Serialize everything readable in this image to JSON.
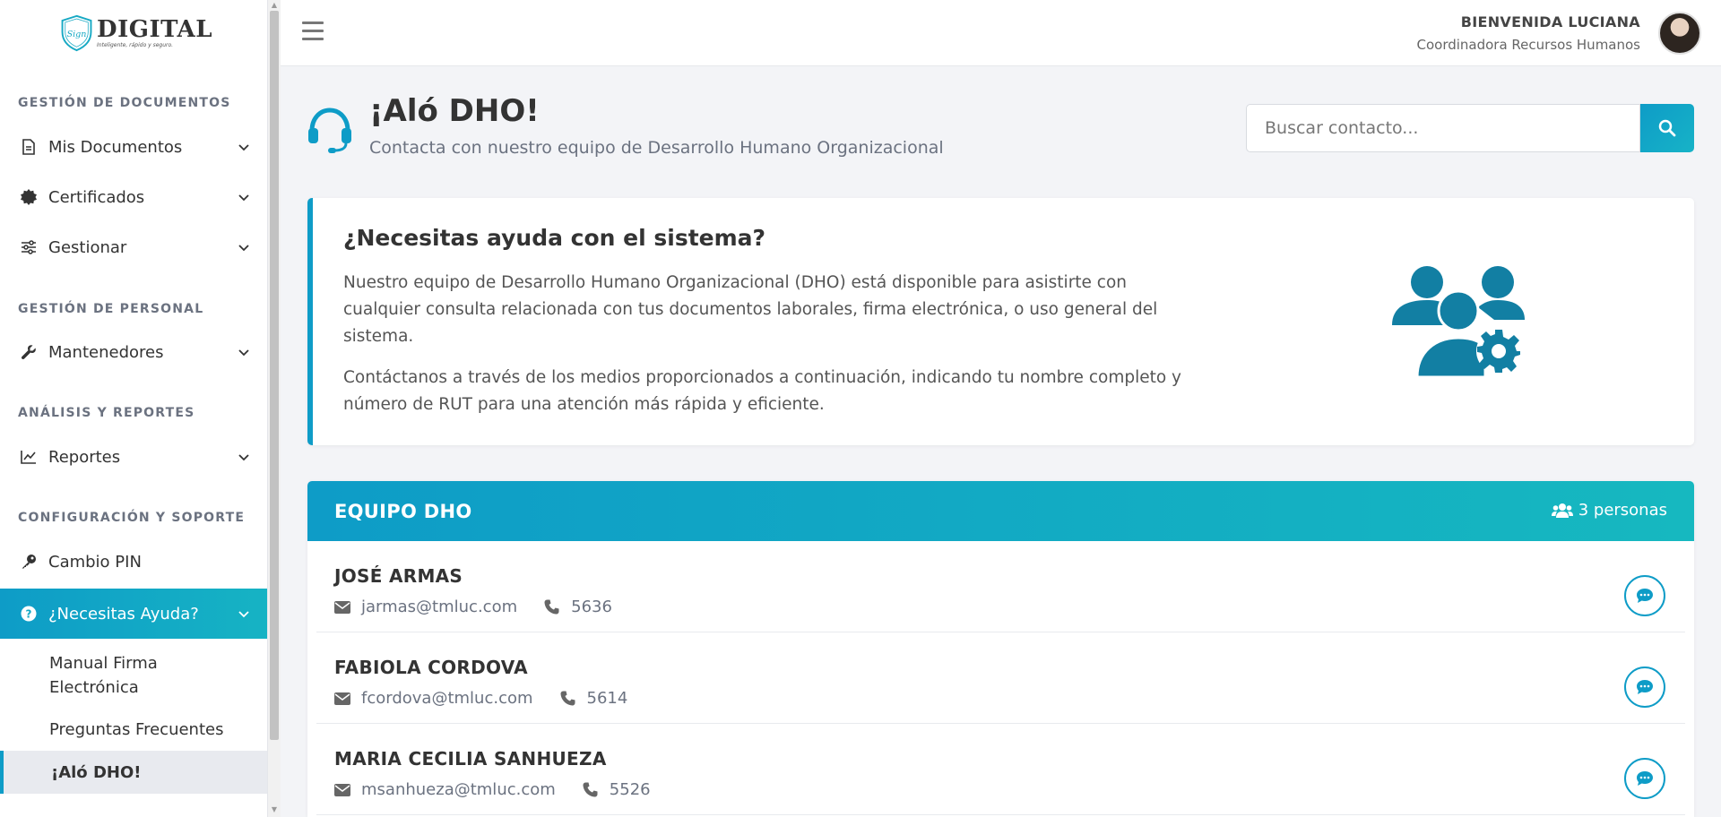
{
  "brand": {
    "logo_script": "Sign",
    "logo_word": "DIGITAL",
    "logo_tagline": "Inteligente, rápido y seguro."
  },
  "sidebar": {
    "sections": [
      {
        "title": "GESTIÓN DE DOCUMENTOS"
      },
      {
        "title": "GESTIÓN DE PERSONAL"
      },
      {
        "title": "ANÁLISIS Y REPORTES"
      },
      {
        "title": "CONFIGURACIÓN Y SOPORTE"
      }
    ],
    "items": [
      {
        "label": "Mis Documentos",
        "icon": "document-icon"
      },
      {
        "label": "Certificados",
        "icon": "certificate-icon"
      },
      {
        "label": "Gestionar",
        "icon": "sliders-icon"
      },
      {
        "label": "Mantenedores",
        "icon": "wrench-icon"
      },
      {
        "label": "Reportes",
        "icon": "chart-line-icon"
      },
      {
        "label": "Cambio PIN",
        "icon": "key-icon"
      },
      {
        "label": "¿Necesitas Ayuda?",
        "icon": "question-circle-icon"
      }
    ],
    "subitems": [
      {
        "label": "Manual Firma Electrónica"
      },
      {
        "label": "Preguntas Frecuentes"
      },
      {
        "label": "¡Aló DHO!"
      }
    ]
  },
  "header": {
    "welcome_prefix": "BIENVENIDA",
    "user_name": "LUCIANA",
    "user_role": "Coordinadora Recursos Humanos"
  },
  "page": {
    "title": "¡Aló DHO!",
    "subtitle": "Contacta con nuestro equipo de Desarrollo Humano Organizacional",
    "search_placeholder": "Buscar contacto..."
  },
  "help": {
    "title": "¿Necesitas ayuda con el sistema?",
    "p1": "Nuestro equipo de Desarrollo Humano Organizacional (DHO) está disponible para asistirte con cualquier consulta relacionada con tus documentos laborales, firma electrónica, o uso general del sistema.",
    "p2": "Contáctanos a través de los medios proporcionados a continuación, indicando tu nombre completo y número de RUT para una atención más rápida y eficiente."
  },
  "team": {
    "title": "EQUIPO DHO",
    "count": "3 personas",
    "contacts": [
      {
        "name": "JOSÉ ARMAS",
        "email": "jarmas@tmluc.com",
        "phone": "5636"
      },
      {
        "name": "FABIOLA CORDOVA",
        "email": "fcordova@tmluc.com",
        "phone": "5614"
      },
      {
        "name": "MARIA CECILIA SANHUEZA",
        "email": "msanhueza@tmluc.com",
        "phone": "5526"
      }
    ]
  },
  "colors": {
    "accent": "#0e9cc7",
    "accent_2": "#16b8c0",
    "illustration": "#127fa3"
  }
}
